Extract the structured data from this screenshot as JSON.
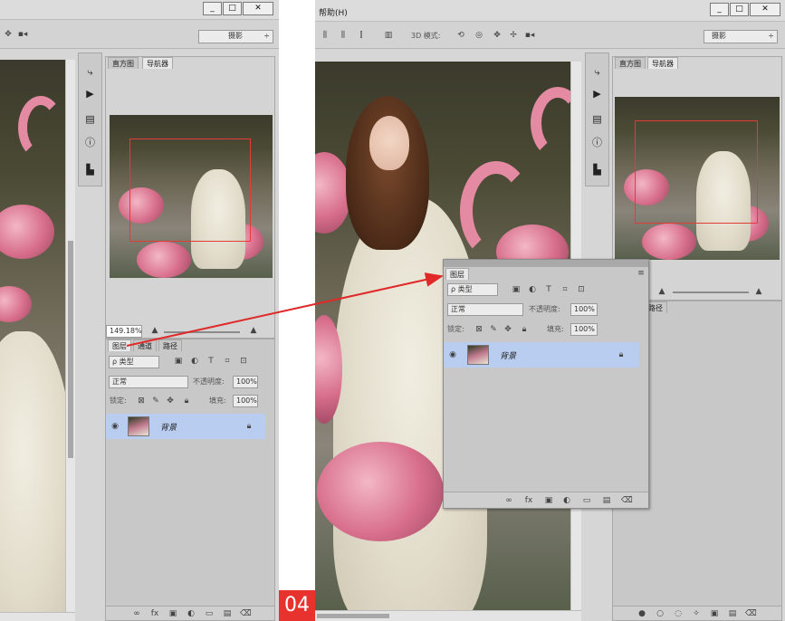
{
  "left": {
    "workspace": "摄影",
    "toolbar_icons": [
      "3d-pan-icon",
      "video-icon"
    ],
    "win_buttons": [
      "_",
      "□",
      "✕"
    ],
    "panel_tabs": [
      "直方图",
      "导航器"
    ],
    "zoom_value": "149.18%",
    "layers_tabs": [
      "图层",
      "通道",
      "路径"
    ],
    "filter_label": "ρ 类型",
    "blend_mode": "正常",
    "opacity_label": "不透明度:",
    "opacity_value": "100%",
    "lock_label": "锁定:",
    "fill_label": "填充:",
    "fill_value": "100%",
    "layer_name": "背景"
  },
  "right": {
    "menu_item": "帮助(H)",
    "mode_label": "3D 模式:",
    "workspace": "摄影",
    "win_buttons": [
      "_",
      "□",
      "✕"
    ],
    "panel_tabs": [
      "直方图",
      "导航器"
    ],
    "partial_tab": "路径",
    "floating": {
      "tab": "图层",
      "filter_label": "ρ 类型",
      "blend_mode": "正常",
      "opacity_label": "不透明度:",
      "opacity_value": "100%",
      "lock_label": "锁定:",
      "fill_label": "填充:",
      "fill_value": "100%",
      "layer_name": "背景"
    }
  },
  "step_badge": "04",
  "colors": {
    "badge": "#e8322e",
    "arrow": "#e02a2a",
    "selected_layer": "#b8cdf0",
    "nav_box": "#e53a3a"
  }
}
